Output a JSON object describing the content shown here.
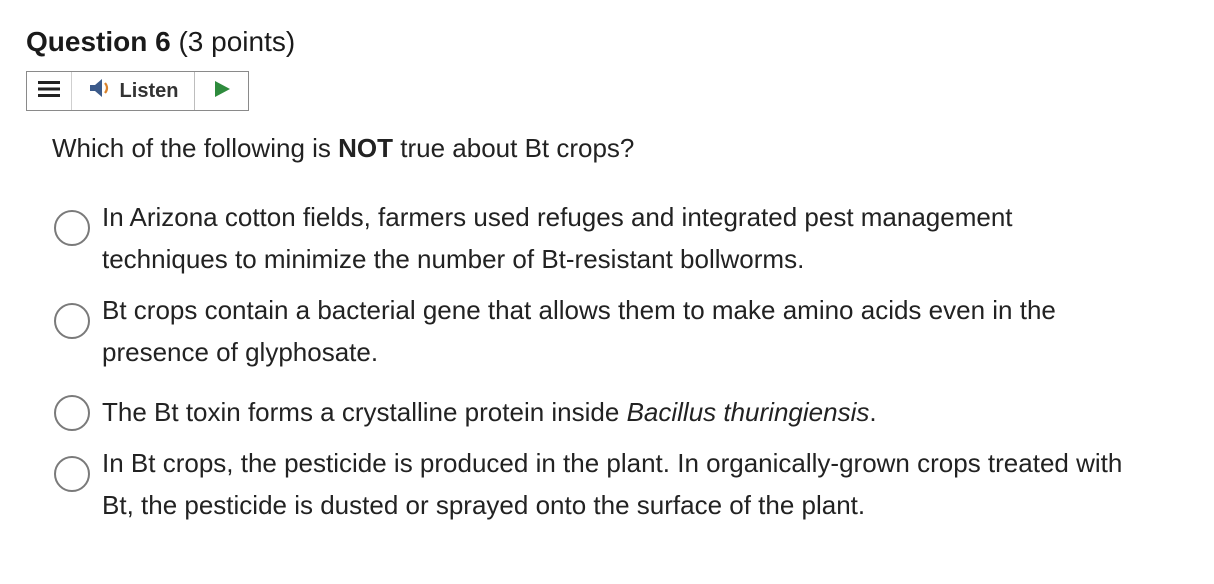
{
  "question": {
    "title": "Question 6",
    "points": "(3 points)"
  },
  "listen_bar": {
    "menu_icon": "hamburger-menu-icon",
    "speaker_icon": "speaker-icon",
    "listen_label": "Listen",
    "play_icon": "play-icon",
    "play_color": "#2e8b3d"
  },
  "prompt": {
    "before": "Which of the following is ",
    "emphasis": "NOT",
    "after": " true about Bt crops?"
  },
  "options": [
    {
      "text": "In Arizona cotton fields, farmers used refuges and integrated pest management techniques to minimize the number of Bt-resistant bollworms."
    },
    {
      "text": "Bt crops contain a bacterial gene that allows them to make amino acids even in the presence of glyphosate."
    },
    {
      "text_before": "The Bt toxin forms a crystalline protein inside ",
      "text_italic": "Bacillus thuringiensis",
      "text_after": "."
    },
    {
      "text": "In Bt crops, the pesticide is produced in the plant. In organically-grown crops treated with Bt, the pesticide is dusted or sprayed onto the surface of the plant."
    }
  ]
}
